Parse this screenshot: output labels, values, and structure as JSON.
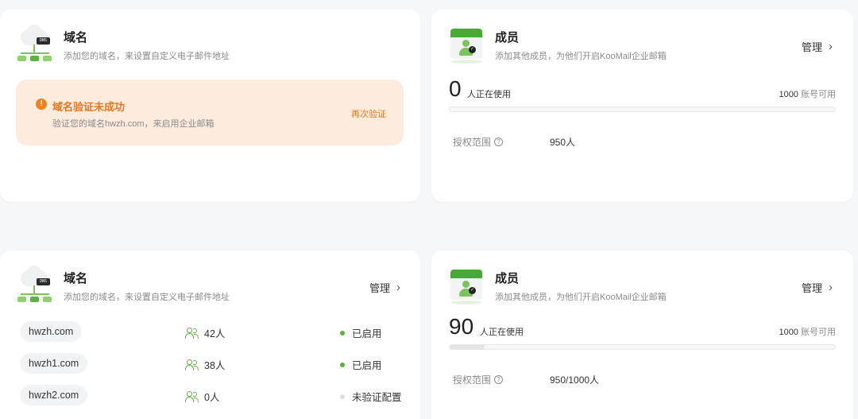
{
  "colors": {
    "accent_green": "#5cb23f",
    "warning_orange": "#e8761a",
    "warning_bg": "#fdebdd",
    "inactive_dot": "#e0e0e0"
  },
  "domain_card_1": {
    "title": "域名",
    "desc": "添加您的域名，来设置自定义电子邮件地址",
    "dns_tag": "DNS",
    "warning": {
      "title": "域名验证未成功",
      "desc": "验证您的域名hwzh.com，来启用企业邮箱",
      "action": "再次验证"
    }
  },
  "member_card_1": {
    "title": "成员",
    "desc": "添加其他成员，为他们开启KooMail企业邮箱",
    "manage": "管理",
    "in_use_count": "0",
    "in_use_label": "人正在使用",
    "available_count": "1000",
    "available_label": "账号可用",
    "usage_fraction": 0.0,
    "scope_label": "授权范围",
    "scope_value": "950人"
  },
  "domain_card_2": {
    "title": "域名",
    "desc": "添加您的域名，来设置自定义电子邮件地址",
    "dns_tag": "DNS",
    "manage": "管理",
    "rows": [
      {
        "domain": "hwzh.com",
        "users": "42人",
        "status": "已启用",
        "status_color": "#5cb23f"
      },
      {
        "domain": "hwzh1.com",
        "users": "38人",
        "status": "已启用",
        "status_color": "#5cb23f"
      },
      {
        "domain": "hwzh2.com",
        "users": "0人",
        "status": "未验证配置",
        "status_color": "#e0e0e0"
      }
    ]
  },
  "member_card_2": {
    "title": "成员",
    "desc": "添加其他成员，为他们开启KooMail企业邮箱",
    "manage": "管理",
    "in_use_count": "90",
    "in_use_label": "人正在使用",
    "available_count": "1000",
    "available_label": "账号可用",
    "usage_fraction": 0.09,
    "scope_label": "授权范围",
    "scope_value": "950/1000人"
  }
}
